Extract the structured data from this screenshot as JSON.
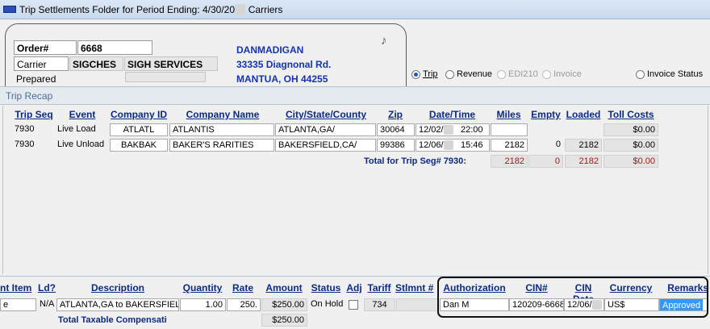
{
  "window": {
    "title": "Trip Settlements Folder for Period Ending: 4/30/20",
    "title_suffix": "Carriers"
  },
  "header": {
    "order_label": "Order#",
    "order_value": "6668",
    "carrier_label": "Carrier",
    "carrier_code": "SIGCHES",
    "carrier_name": "SIGH SERVICES",
    "prepared_label": "Prepared",
    "address": {
      "line1": "DANMADIGAN",
      "line2": "33335 Diagnonal Rd.",
      "line3": "MANTUA, OH 44255"
    }
  },
  "radios": {
    "trip": "Trip",
    "revenue": "Revenue",
    "edi210": "EDI210",
    "invoice": "Invoice",
    "invoice_status": "Invoice Status"
  },
  "recap": {
    "title": "Trip Recap",
    "headers": {
      "trip_seq": "Trip Seq",
      "event": "Event",
      "company_id": "Company ID",
      "company_name": "Company Name",
      "city": "City/State/County",
      "zip": "Zip",
      "datetime": "Date/Time",
      "miles": "Miles",
      "empty": "Empty",
      "loaded": "Loaded",
      "toll": "Toll Costs"
    },
    "rows": [
      {
        "trip_seq": "7930",
        "event": "Live Load",
        "company_id": "ATLATL",
        "company_name": "ATLANTIS",
        "city": "ATLANTA,GA/",
        "zip": "30064",
        "date": "12/02/",
        "time": "22:00",
        "miles": "",
        "empty": "",
        "loaded": "",
        "toll": "$0.00"
      },
      {
        "trip_seq": "7930",
        "event": "Live Unload",
        "company_id": "BAKBAK",
        "company_name": "BAKER'S RARITIES",
        "city": "BAKERSFIELD,CA/",
        "zip": "99386",
        "date": "12/06/",
        "time": "15:46",
        "miles": "2182",
        "empty": "0",
        "loaded": "2182",
        "toll": "$0.00"
      }
    ],
    "total": {
      "label": "Total for Trip Seg# 7930:",
      "miles": "2182",
      "empty": "0",
      "loaded": "2182",
      "toll": "$0.00"
    }
  },
  "lower": {
    "headers": {
      "item": "nt Item",
      "ld": "Ld?",
      "description": "Description",
      "quantity": "Quantity",
      "rate": "Rate",
      "amount": "Amount",
      "status": "Status",
      "adj": "Adj",
      "tariff": "Tariff",
      "stlmnt": "Stlmnt #",
      "authorization": "Authorization",
      "cin": "CIN#",
      "cin_date": "CIN Date",
      "currency": "Currency",
      "remarks": "Remarks"
    },
    "row": {
      "item": "e",
      "ld": "N/A",
      "description": "ATLANTA,GA to BAKERSFIELD",
      "quantity": "1.00",
      "rate": "250.",
      "amount": "$250.00",
      "status": "On Hold",
      "tariff": "734",
      "authorization": "Dan M",
      "cin": "120209-6668",
      "cin_date": "12/06/",
      "currency": "US$",
      "remarks": "Approved"
    },
    "total_label": "Total Taxable Compensati",
    "total_amount": "$250.00"
  },
  "colors": {
    "link_blue": "#0b2a88",
    "address_blue": "#1534b5",
    "total_red": "#a01818",
    "selection": "#3399ff"
  }
}
